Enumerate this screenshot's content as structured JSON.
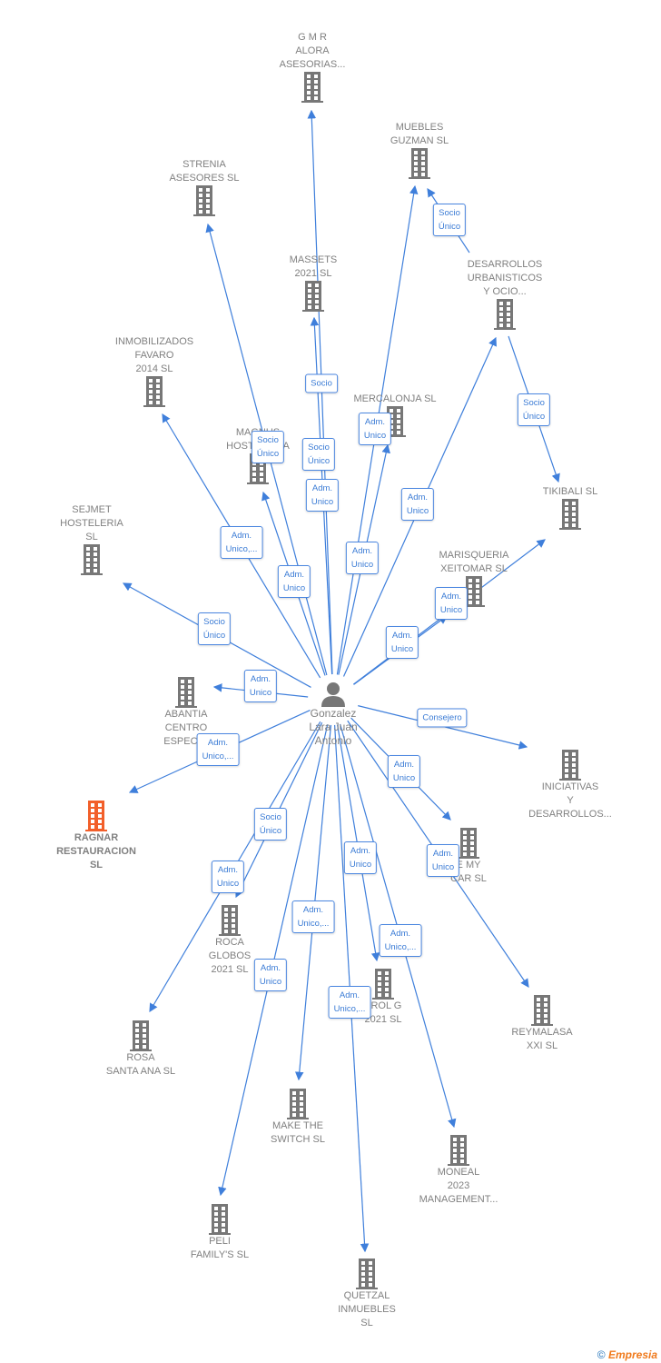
{
  "center": {
    "name": "Gonzalez\nLara Juan\nAntonio",
    "icon": "person-icon"
  },
  "colors": {
    "edge": "#3f7fdb",
    "building": "#777777",
    "highlight": "#f25f2a"
  },
  "nodes": [
    {
      "name": "G M R\nALORA\nASESORIAS..."
    },
    {
      "name": "MUEBLES\nGUZMAN  SL"
    },
    {
      "name": "STRENIA\nASESORES  SL"
    },
    {
      "name": "MASSETS\n2021  SL"
    },
    {
      "name": "DESARROLLOS\nURBANISTICOS\nY OCIO..."
    },
    {
      "name": "INMOBILIZADOS\nFAVARO\n2014  SL"
    },
    {
      "name": "MERCALONJA SL"
    },
    {
      "name": "MAGNUS\nHOSTELERIA"
    },
    {
      "name": "TIKIBALI  SL"
    },
    {
      "name": "SEJMET\nHOSTELERIA\nSL"
    },
    {
      "name": "MARISQUERIA\nXEITOMAR  SL"
    },
    {
      "name": "ABANTIA\nCENTRO\nESPECI..."
    },
    {
      "name": "INICIATIVAS\nY\nDESARROLLOS..."
    },
    {
      "name": "RAGNAR\nRESTAURACION\nSL",
      "highlight": true
    },
    {
      "name": "E MY\nCAR  SL"
    },
    {
      "name": "ROCA\nGLOBOS\n2021  SL"
    },
    {
      "name": "TROL G\n2021  SL"
    },
    {
      "name": "REYMALASA\nXXI SL"
    },
    {
      "name": "ROSA\nSANTA ANA  SL"
    },
    {
      "name": "MAKE THE\nSWITCH  SL"
    },
    {
      "name": "MONEAL\n2023\nMANAGEMENT..."
    },
    {
      "name": "PELI\nFAMILY'S SL"
    },
    {
      "name": "QUETZAL\nINMUEBLES\nSL"
    }
  ],
  "edge_labels": [
    "Socio",
    "Socio\nÚnico",
    "Adm.\nUnico",
    "Socio\nÚnico",
    "Socio\nÚnico",
    "Adm.\nUnico",
    "Adm.\nUnico",
    "Socio\nÚnico",
    "Adm.\nUnico,...",
    "Adm.\nUnico",
    "Adm.\nUnico",
    "Adm.\nUnico",
    "Socio\nÚnico",
    "Adm.\nUnico",
    "Adm.\nUnico",
    "Consejero",
    "Adm.\nUnico,...",
    "Adm.\nUnico",
    "Socio\nÚnico",
    "Adm.\nUnico",
    "Adm.\nUnico",
    "Adm.\nUnico",
    "Adm.\nUnico,...",
    "Adm.\nUnico,...",
    "Adm.\nUnico",
    "Adm.\nUnico,..."
  ],
  "footer": {
    "copyright": "©",
    "brand": "Empresia"
  }
}
